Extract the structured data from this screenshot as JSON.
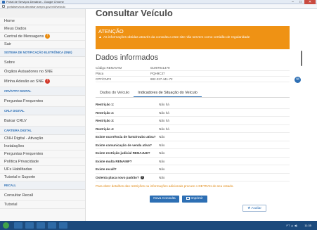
{
  "browser": {
    "window_title": "Portal de Serviços Denatran - Google Chrome",
    "url": "portalservicos.denatran.serpro.gov.br/#/veiculo",
    "minimize": "–",
    "maximize": "□",
    "close": "✕"
  },
  "sidebar": {
    "items_top": [
      {
        "label": "Home"
      },
      {
        "label": "Meus Dados"
      },
      {
        "label": "Central de Mensagens",
        "badge": "!"
      },
      {
        "label": "Sair"
      }
    ],
    "section_sne": "SISTEMA DE NOTIFICAÇÃO ELETRÔNICA (SNE)",
    "items_sne": [
      {
        "label": "Sobre"
      },
      {
        "label": "Órgãos Autuadores no SNE"
      },
      {
        "label": "Minha Adesão ao SNE",
        "badge": "!"
      }
    ],
    "section_crv": "CRV/VTPV DIGITAL",
    "items_crv": [
      {
        "label": "Perguntas Frequentes"
      }
    ],
    "section_crlv": "CRLV DIGITAL",
    "items_crlv": [
      {
        "label": "Baixar CRLV"
      }
    ],
    "section_carteira": "CARTEIRA DIGITAL",
    "items_carteira": [
      {
        "label": "CNH Digital - Ativação"
      },
      {
        "label": "Instalações"
      },
      {
        "label": "Perguntas Frequentes"
      },
      {
        "label": "Política Privacidade"
      },
      {
        "label": "UFs Habilitadas"
      },
      {
        "label": "Tutorial e Suporte"
      }
    ],
    "section_recall": "RECALL",
    "items_recall": [
      {
        "label": "Consultar Recall"
      },
      {
        "label": "Tutorial"
      }
    ]
  },
  "main": {
    "title": "Consultar Veículo",
    "warning": {
      "heading": "ATENÇÃO",
      "message": "As informações obtidas através da consulta a este site não servem como certidão de regularidade"
    },
    "section_title": "Dados informados",
    "info": [
      {
        "label": "Código RENAVAM",
        "value": "01097941479"
      },
      {
        "label": "Placa",
        "value": "PQH9C37"
      },
      {
        "label": "CPF/CNPJ",
        "value": "882.227.441-72"
      }
    ],
    "tabs": [
      {
        "label": "Dados do Veículo",
        "active": false
      },
      {
        "label": "Indicadores de Situação do Veículo",
        "active": true
      }
    ],
    "results": [
      {
        "label": "Restrição 1:",
        "value": "Não há"
      },
      {
        "label": "Restrição 2:",
        "value": "Não há"
      },
      {
        "label": "Restrição 3:",
        "value": "Não há"
      },
      {
        "label": "Restrição 4:",
        "value": "Não há"
      },
      {
        "label": "Existe ocorrência de furto/roubo ativa?",
        "value": "Não"
      },
      {
        "label": "Existe comunicação de venda ativa?",
        "value": "Não"
      },
      {
        "label": "Existe restrição judicial RENAJUD?",
        "value": "Não"
      },
      {
        "label": "Existe multa RENAINF?",
        "value": "Não"
      },
      {
        "label": "Existe recall?",
        "value": "Não"
      },
      {
        "label": "Ostenta placa novo padrão?",
        "value": "Não",
        "help": "?"
      }
    ],
    "note": "Para obter detalhes das restrições ou informações adicionais procure o DETRAN do seu estado.",
    "btn_new": "Nova Consulta",
    "btn_print": "Imprimir",
    "btn_rate": "Avaliar",
    "float_icon": "chat-icon"
  },
  "taskbar": {
    "tray": "PT ▲ ◀)",
    "clock": "11:35"
  },
  "colors": {
    "accent": "#2d6fb4",
    "warning": "#ef9214",
    "taskbar": "#1c4a7c"
  }
}
